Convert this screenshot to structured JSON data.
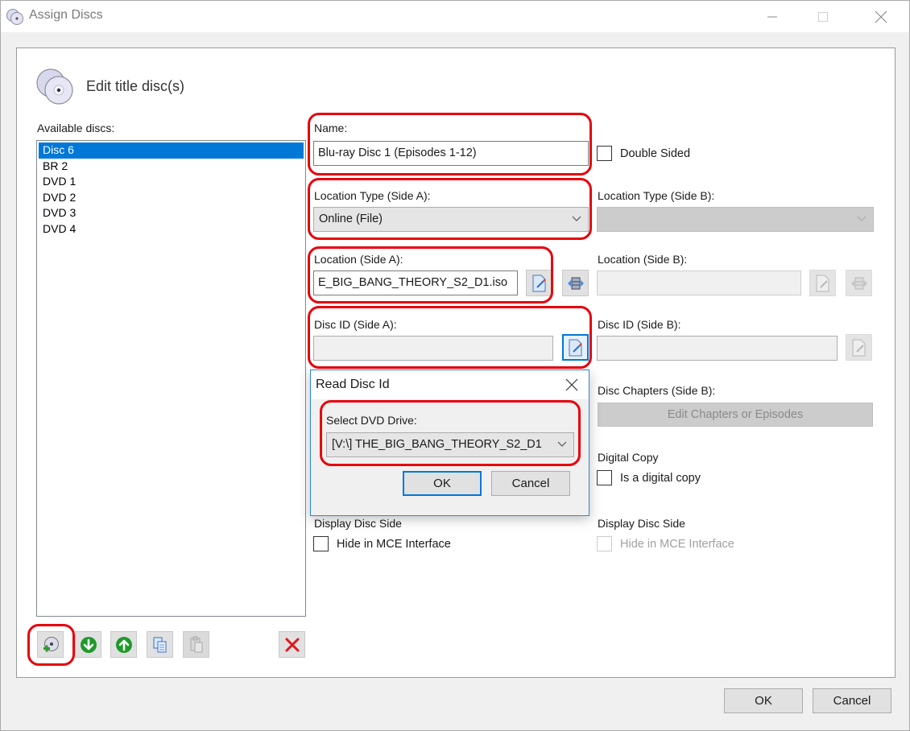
{
  "window": {
    "title": "Assign Discs",
    "icon": "discs-icon",
    "controls": [
      "minimize-icon",
      "maximize-icon",
      "close-icon"
    ]
  },
  "header": {
    "title": "Edit title disc(s)",
    "icon": "discs-icon"
  },
  "available_discs": {
    "label": "Available discs:",
    "items": [
      {
        "label": "Disc 6",
        "selected": true
      },
      {
        "label": "BR 2",
        "selected": false
      },
      {
        "label": "DVD 1",
        "selected": false
      },
      {
        "label": "DVD 2",
        "selected": false
      },
      {
        "label": "DVD 3",
        "selected": false
      },
      {
        "label": "DVD 4",
        "selected": false
      }
    ],
    "toolbar": [
      {
        "name": "add-disc",
        "icon": "add-disc-icon",
        "enabled": true
      },
      {
        "name": "move-down",
        "icon": "arrow-down-icon",
        "enabled": true
      },
      {
        "name": "move-up",
        "icon": "arrow-up-icon",
        "enabled": true
      },
      {
        "name": "copy",
        "icon": "copy-icon",
        "enabled": true
      },
      {
        "name": "paste",
        "icon": "paste-icon",
        "enabled": false
      },
      {
        "name": "delete",
        "icon": "delete-icon",
        "enabled": true
      }
    ]
  },
  "side_a": {
    "name_label": "Name:",
    "name_value": "Blu-ray Disc 1 (Episodes 1-12)",
    "location_type_label": "Location Type (Side A):",
    "location_type_value": "Online (File)",
    "location_label": "Location (Side A):",
    "location_value": "E_BIG_BANG_THEORY_S2_D1.iso",
    "disc_id_label": "Disc ID (Side A):",
    "disc_id_value": "",
    "display_disc_side_label": "Display Disc Side",
    "hide_mce_label": "Hide in MCE Interface",
    "hide_mce_checked": false
  },
  "side_b": {
    "double_sided_label": "Double Sided",
    "double_sided_checked": false,
    "location_type_label": "Location Type (Side B):",
    "location_type_value": "",
    "location_label": "Location (Side B):",
    "location_value": "",
    "disc_id_label": "Disc ID (Side B):",
    "disc_id_value": "",
    "disc_chapters_label": "Disc Chapters (Side B):",
    "edit_chapters_label": "Edit Chapters or Episodes",
    "digital_copy_label": "Digital Copy",
    "is_digital_copy_label": "Is a digital copy",
    "is_digital_copy_checked": false,
    "display_disc_side_label": "Display Disc Side",
    "hide_mce_label": "Hide in MCE Interface",
    "hide_mce_checked": false
  },
  "read_disc_dialog": {
    "title": "Read Disc Id",
    "select_label": "Select DVD Drive:",
    "drive_value": "[V:\\] THE_BIG_BANG_THEORY_S2_D1",
    "ok_label": "OK",
    "cancel_label": "Cancel"
  },
  "footer": {
    "ok_label": "OK",
    "cancel_label": "Cancel"
  },
  "highlight_color": "#e8000b",
  "selection_color": "#0078d7"
}
